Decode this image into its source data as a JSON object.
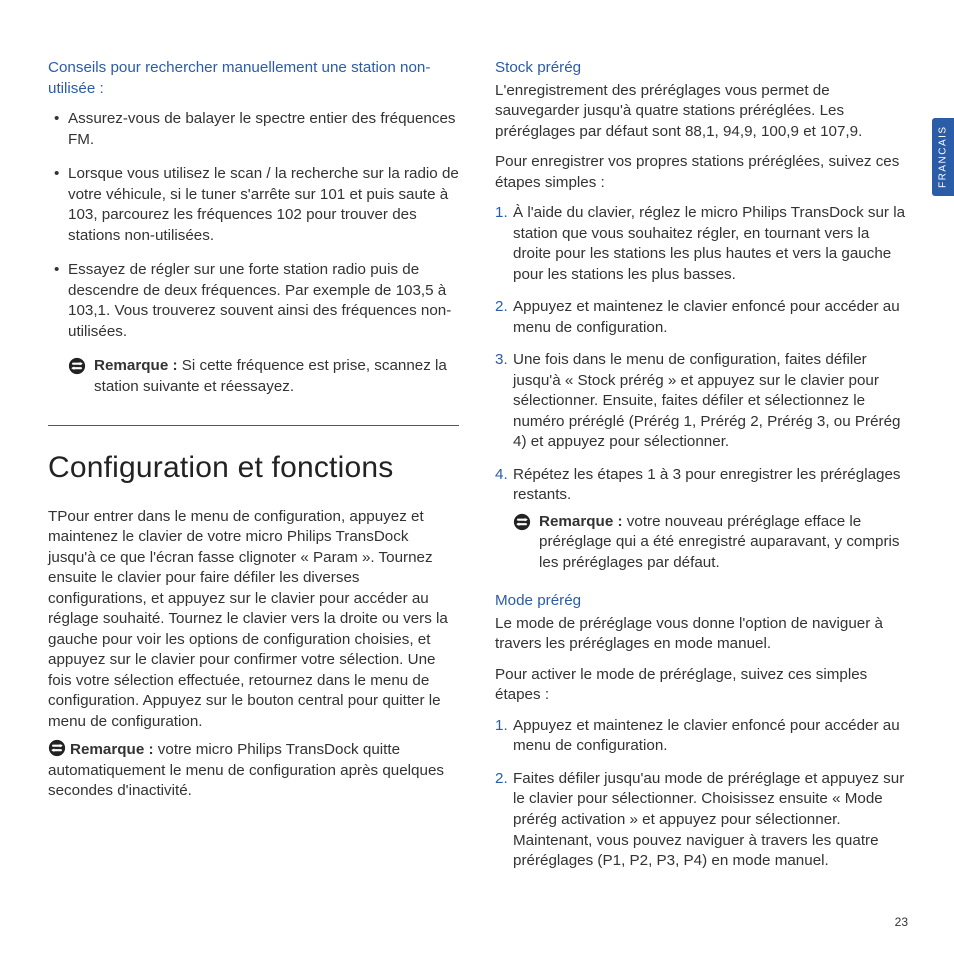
{
  "sideTab": "FRANCAIS",
  "pageNumber": "23",
  "left": {
    "tipsHeading": "Conseils pour rechercher manuellement une station non-utilisée :",
    "bullets": [
      "Assurez-vous de balayer le spectre entier des fréquences FM.",
      "Lorsque vous utilisez le scan / la recherche sur la radio de votre véhicule, si le tuner s'arrête sur 101 et puis saute à 103, parcourez les fréquences 102 pour trouver des stations non-utilisées.",
      "Essayez de régler sur une forte station radio puis de descendre de deux fréquences. Par exemple de 103,5 à 103,1. Vous trouverez souvent ainsi des fréquences non-utilisées."
    ],
    "remark1Label": "Remarque :",
    "remark1Text": " Si cette fréquence est prise, scannez la station suivante et réessayez.",
    "sectionTitle": "Configuration et fonctions",
    "sectionBody": "TPour entrer dans le menu de configuration, appuyez et maintenez le clavier de votre micro Philips TransDock jusqu'à ce que l'écran fasse clignoter « Param ». Tournez ensuite le clavier pour faire défiler les diverses configurations, et appuyez sur le clavier pour accéder au réglage souhaité. Tournez le clavier vers la droite ou vers la gauche pour voir les options de configuration choisies, et appuyez sur le clavier pour confirmer votre sélection. Une fois votre sélection effectuée, retournez dans le menu de configuration. Appuyez sur le bouton central pour quitter le menu de configuration.",
    "remark2Label": "Remarque :",
    "remark2Text": " votre micro Philips TransDock quitte automatiquement le menu de configuration après quelques secondes d'inactivité."
  },
  "right": {
    "stock": {
      "heading": "Stock prérég",
      "intro": "L'enregistrement des préréglages vous permet de sauvegarder jusqu'à quatre stations préréglées. Les préréglages par défaut sont 88,1, 94,9, 100,9 et 107,9.",
      "lead": "Pour enregistrer vos propres stations préréglées, suivez ces étapes simples :",
      "steps": [
        "À l'aide du clavier, réglez le micro Philips TransDock sur la station que vous souhaitez régler, en tournant vers la droite pour les stations les plus hautes et vers la gauche pour les stations les plus basses.",
        "Appuyez et maintenez le clavier enfoncé pour accéder au menu de configuration.",
        "Une fois dans le menu de configuration, faites défiler jusqu'à « Stock prérég » et appuyez sur le clavier pour sélectionner. Ensuite, faites défiler et sélectionnez le numéro préréglé (Prérég 1, Prérég 2, Prérég 3, ou Prérég 4) et appuyez pour sélectionner.",
        "Répétez les étapes 1 à 3 pour enregistrer les préréglages restants."
      ],
      "remarkLabel": "Remarque :",
      "remarkText": " votre nouveau préréglage efface le préréglage qui a été enregistré auparavant, y compris les préréglages par défaut."
    },
    "mode": {
      "heading": "Mode prérég",
      "intro": "Le mode de préréglage vous donne l'option de naviguer à travers les préréglages en mode manuel.",
      "lead": "Pour activer le mode de préréglage, suivez ces simples étapes :",
      "steps": [
        "Appuyez et maintenez le clavier enfoncé pour accéder au menu de configuration.",
        "Faites défiler jusqu'au mode de préréglage et appuyez sur le clavier pour sélectionner. Choisissez ensuite « Mode prérég activation » et appuyez pour sélectionner. Maintenant, vous pouvez naviguer à travers les quatre préréglages (P1, P2, P3, P4) en mode manuel."
      ]
    }
  }
}
